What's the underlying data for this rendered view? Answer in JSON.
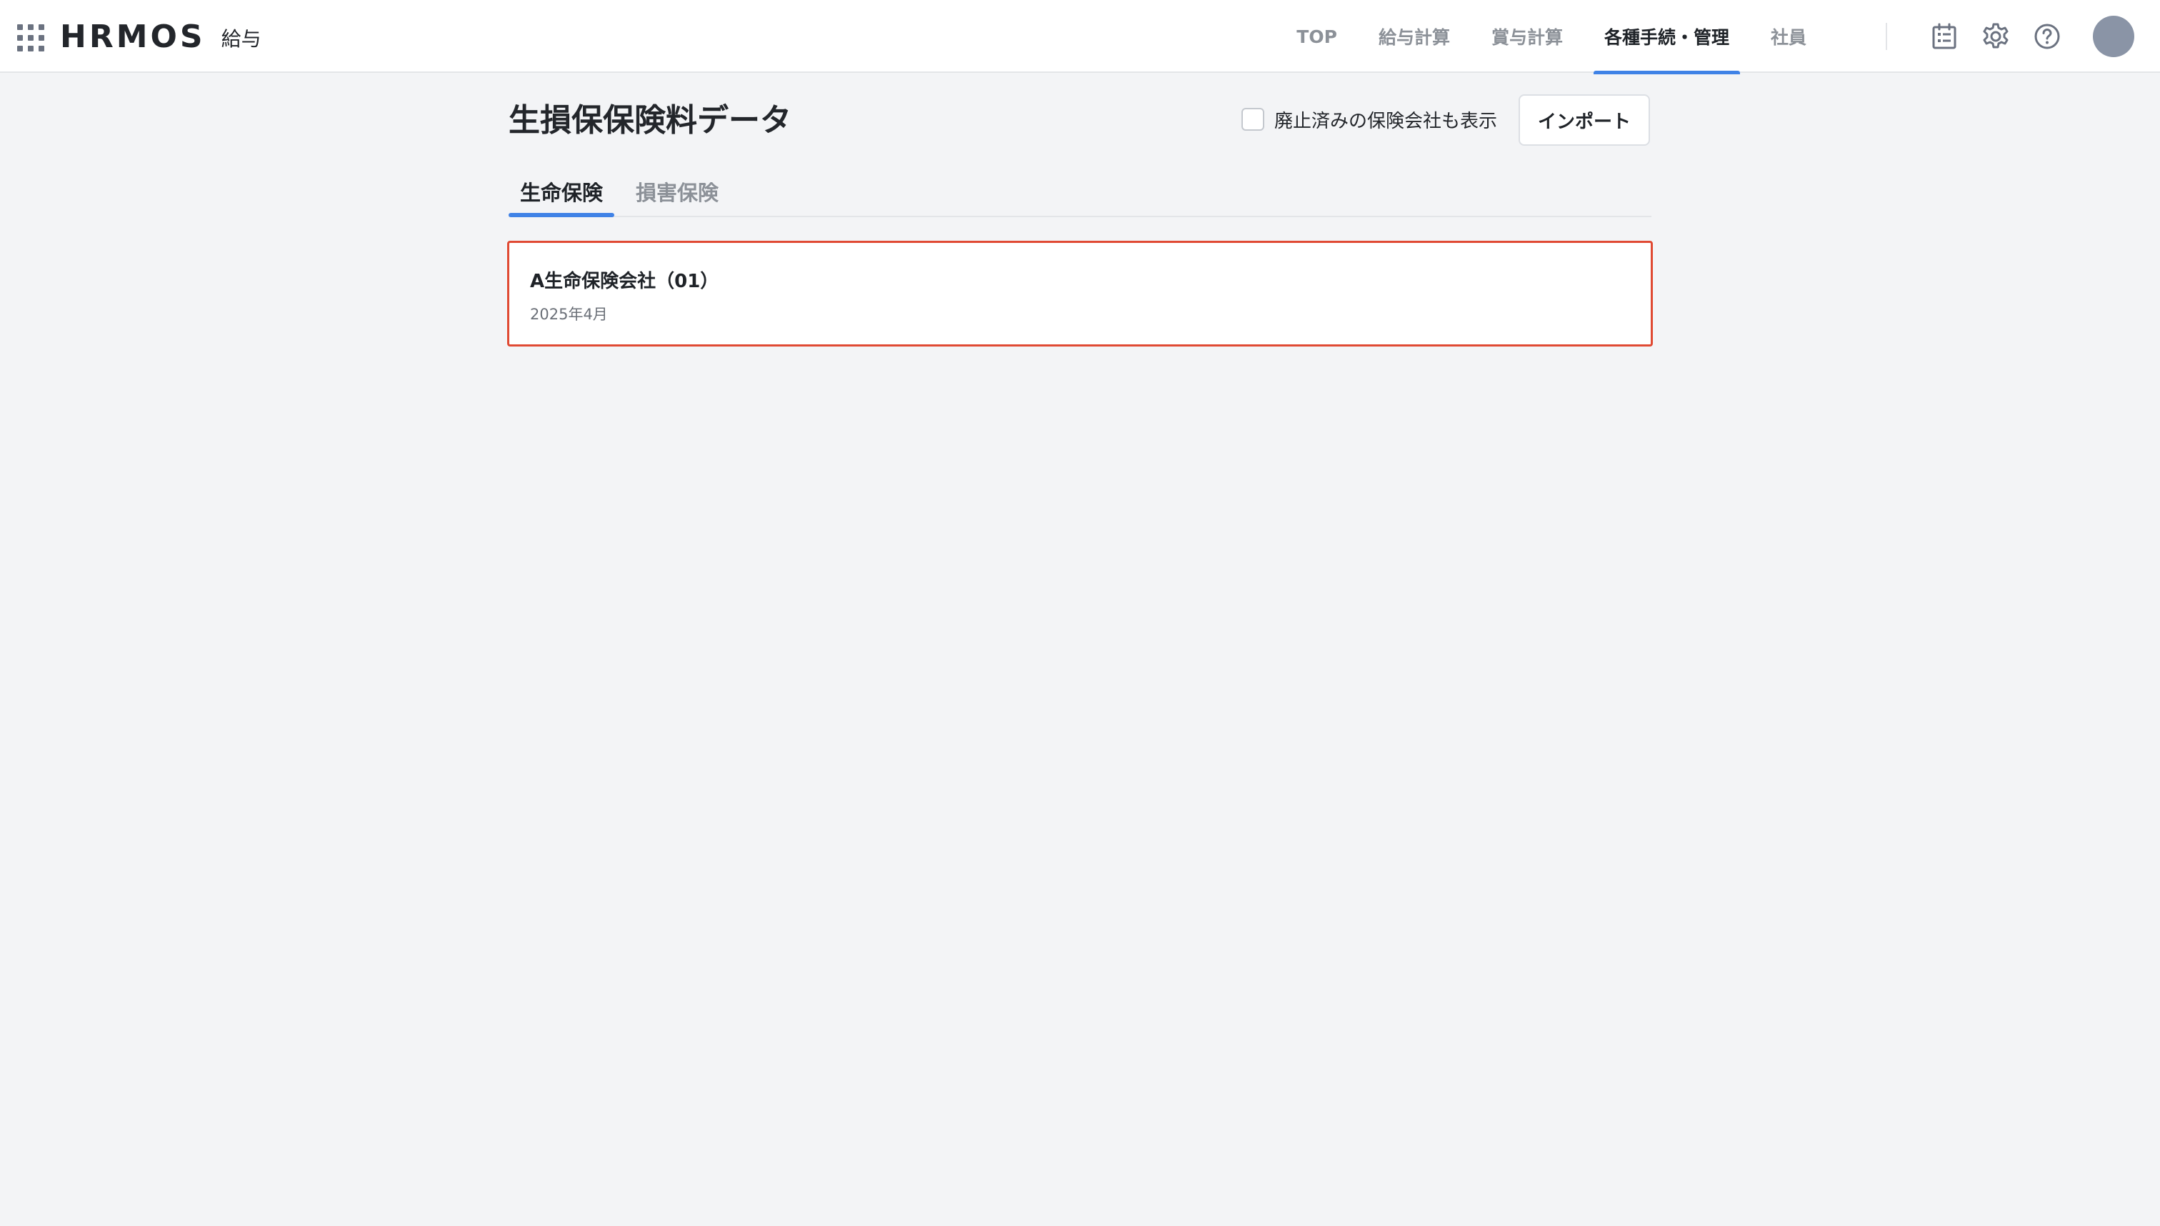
{
  "header": {
    "logo": "HRMOS",
    "product": "給与",
    "nav": [
      {
        "label": "TOP",
        "active": false
      },
      {
        "label": "給与計算",
        "active": false
      },
      {
        "label": "賞与計算",
        "active": false
      },
      {
        "label": "各種手続・管理",
        "active": true
      },
      {
        "label": "社員",
        "active": false
      }
    ],
    "icons": [
      "calendar-list-icon",
      "gear-icon",
      "help-icon"
    ]
  },
  "page": {
    "title": "生損保保険料データ",
    "show_retired_label": "廃止済みの保険会社も表示",
    "show_retired_checked": false,
    "import_label": "インポート"
  },
  "tabs": [
    {
      "label": "生命保険",
      "active": true
    },
    {
      "label": "損害保険",
      "active": false
    }
  ],
  "companies": [
    {
      "name": "A生命保険会社（01）",
      "date": "2025年4月"
    }
  ],
  "colors": {
    "accent": "#3f82e6",
    "highlight_border": "#e04a33",
    "background": "#f3f4f6",
    "avatar": "#8a94a6"
  }
}
